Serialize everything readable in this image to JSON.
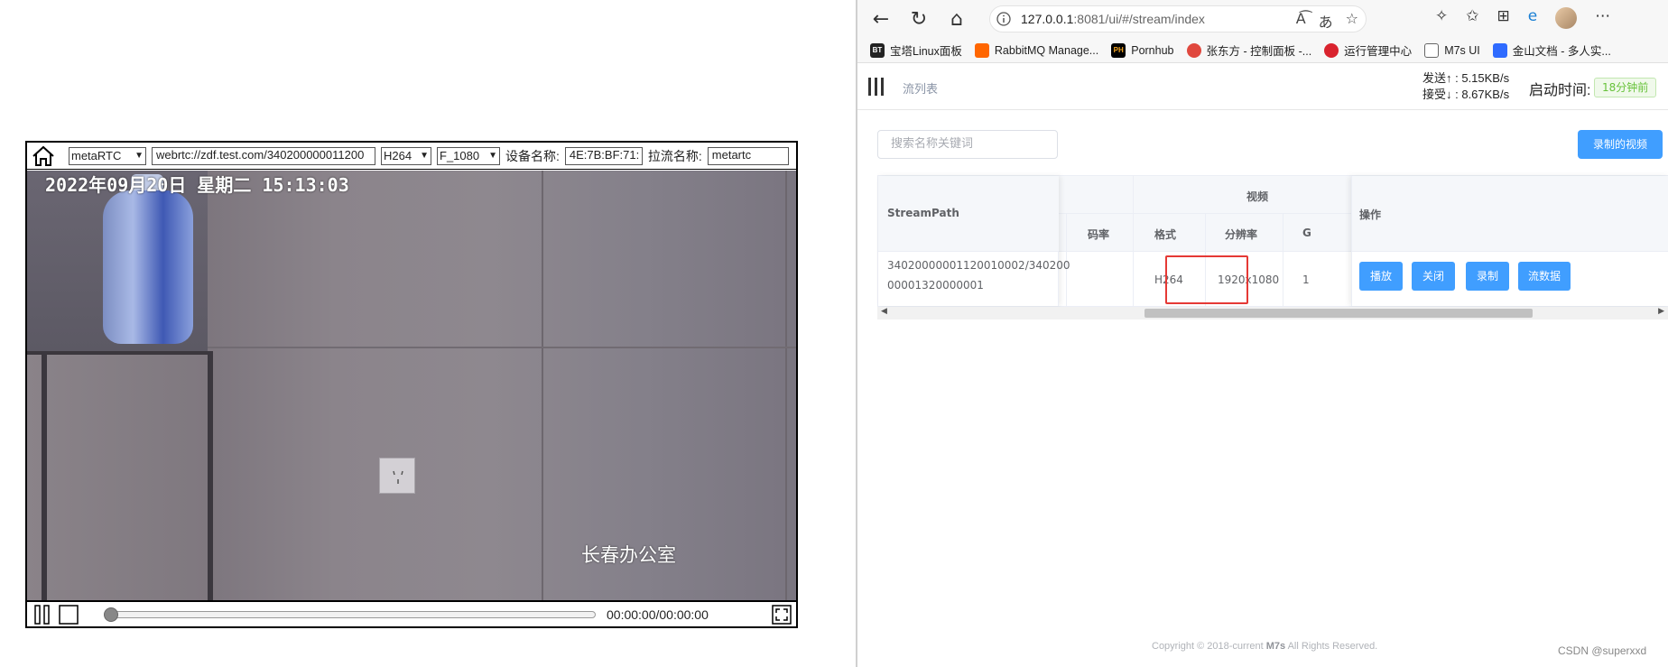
{
  "player": {
    "protocol_select": "metaRTC",
    "url_value": "webrtc://zdf.test.com/340200000011200",
    "codec_select": "H264",
    "quality_select": "F_1080",
    "device_label": "设备名称:",
    "device_value": "4E:7B:BF:71:",
    "stream_label": "拉流名称:",
    "stream_value": "metartc",
    "osd_datetime": "2022年09月20日  星期二  15:13:03",
    "osd_location": "长春办公室",
    "time_display": "00:00:00/00:00:00",
    "progress": 0
  },
  "browser": {
    "url_host": "127.0.0.1",
    "url_path": ":8081/ui/#/stream/index",
    "bookmarks": [
      {
        "label": "宝塔Linux面板",
        "icon": "BT",
        "color": "#222222"
      },
      {
        "label": "RabbitMQ Manage...",
        "icon": "",
        "color": "#ff6600"
      },
      {
        "label": "Pornhub",
        "icon": "PH",
        "color": "#f5a623"
      },
      {
        "label": "张东方 - 控制面板 -...",
        "icon": "",
        "color": "#e0483e"
      },
      {
        "label": "运行管理中心",
        "icon": "",
        "color": "#d9232e"
      },
      {
        "label": "M7s UI",
        "icon": "",
        "color": "#ffffff"
      },
      {
        "label": "金山文档 - 多人实...",
        "icon": "",
        "color": "#2f6bff"
      }
    ]
  },
  "app": {
    "breadcrumb": "流列表",
    "send_rate": "发送↑ : 5.15KB/s",
    "recv_rate": "接受↓ : 8.67KB/s",
    "uptime_label": "启动时间:",
    "uptime_value": "18分钟前",
    "search_placeholder": "搜索名称关键词",
    "record_button": "录制的视频",
    "table": {
      "col_streampath": "StreamPath",
      "group_video": "视频",
      "col_bitrate": "码率",
      "col_format": "格式",
      "col_resolution": "分辨率",
      "col_partial": "G",
      "col_ops": "操作",
      "row": {
        "streampath_line1": "34020000001120010002/340200",
        "streampath_line2": "00001320000001",
        "format": "H264",
        "resolution": "1920x1080",
        "partial": "1"
      },
      "buttons": [
        "播放",
        "关闭",
        "录制",
        "流数据"
      ]
    },
    "footer_prefix": "Copyright © 2018-current ",
    "footer_brand": "M7s",
    "footer_suffix": " All Rights Reserved.",
    "watermark": "CSDN @superxxd"
  },
  "colors": {
    "primary": "#409eff",
    "highlight": "#e53935",
    "success": "#67c23a"
  }
}
